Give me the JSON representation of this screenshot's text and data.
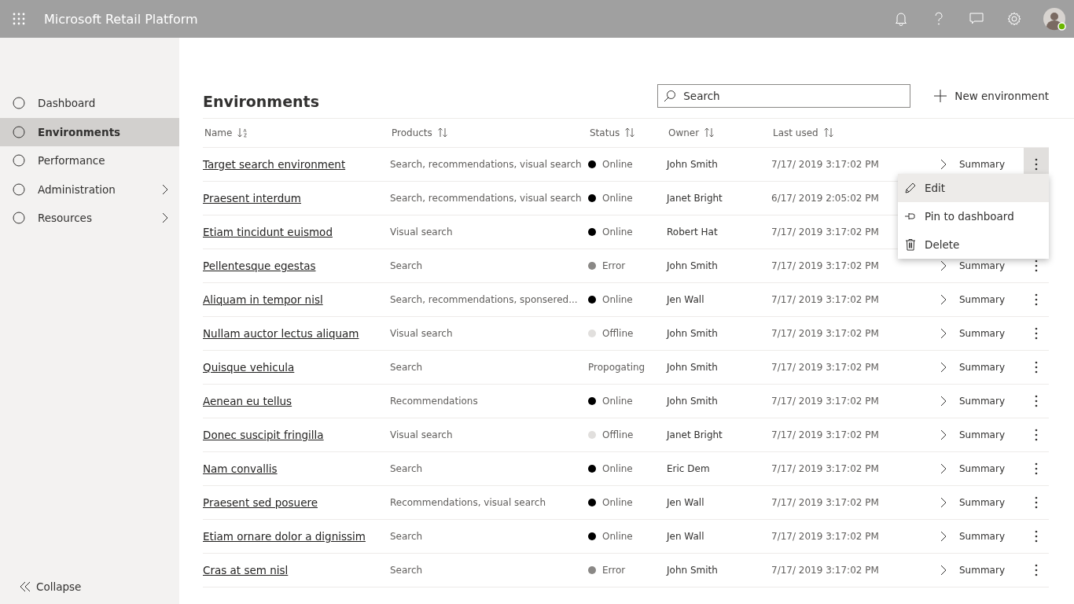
{
  "header": {
    "title": "Microsoft Retail Platform"
  },
  "sidebar": {
    "items": [
      {
        "label": "Dashboard",
        "selected": false,
        "expandable": false
      },
      {
        "label": "Environments",
        "selected": true,
        "expandable": false
      },
      {
        "label": "Performance",
        "selected": false,
        "expandable": false
      },
      {
        "label": "Administration",
        "selected": false,
        "expandable": true
      },
      {
        "label": "Resources",
        "selected": false,
        "expandable": true
      }
    ],
    "collapse": "Collapse"
  },
  "page": {
    "title": "Environments",
    "search": {
      "placeholder": "Search"
    },
    "new_button": "New environment"
  },
  "table": {
    "columns": [
      {
        "label": "Name",
        "kind": "az"
      },
      {
        "label": "Products",
        "kind": "both"
      },
      {
        "label": "Status",
        "kind": "both"
      },
      {
        "label": "Owner",
        "kind": "both"
      },
      {
        "label": "Last used",
        "kind": "both"
      }
    ],
    "rows": [
      {
        "name": "Target search environment",
        "products": "Search, recommendations, visual search",
        "status": "Online",
        "color": "#000000",
        "owner": "John Smith",
        "last_used": "7/17/ 2019 3:17:02 PM",
        "summary": "Summary",
        "more_selected": true
      },
      {
        "name": "Praesent interdum",
        "products": "Search, recommendations, visual search",
        "status": "Online",
        "color": "#000000",
        "owner": "Janet Bright",
        "last_used": "6/17/ 2019 2:05:02 PM"
      },
      {
        "name": "Etiam tincidunt euismod",
        "products": "Visual search",
        "status": "Online",
        "color": "#000000",
        "owner": "Robert Hat",
        "last_used": "7/17/ 2019 3:17:02 PM"
      },
      {
        "name": "Pellentesque egestas",
        "products": "Search",
        "status": "Error",
        "color": "#8a8886",
        "owner": "John Smith",
        "last_used": "7/17/ 2019 3:17:02 PM",
        "summary": "Summary",
        "more_selected": false
      },
      {
        "name": "Aliquam in tempor nisl",
        "products": "Search, recommendations, sponsered...",
        "status": "Online",
        "color": "#000000",
        "owner": "Jen Wall",
        "last_used": "7/17/ 2019 3:17:02 PM",
        "summary": "Summary",
        "more_selected": false
      },
      {
        "name": "Nullam auctor lectus aliquam",
        "products": "Visual search",
        "status": "Offline",
        "color": "#e1dfdd",
        "owner": "John Smith",
        "last_used": "7/17/ 2019 3:17:02 PM",
        "summary": "Summary",
        "more_selected": false
      },
      {
        "name": "Quisque vehicula",
        "products": "Search",
        "status": "Propogating",
        "owner": "John Smith",
        "last_used": "7/17/ 2019 3:17:02 PM",
        "summary": "Summary",
        "more_selected": false
      },
      {
        "name": "Aenean eu tellus",
        "products": "Recommendations",
        "status": "Online",
        "color": "#000000",
        "owner": "John Smith",
        "last_used": "7/17/ 2019 3:17:02 PM",
        "summary": "Summary",
        "more_selected": false
      },
      {
        "name": "Donec suscipit fringilla",
        "products": "Visual search",
        "status": "Offline",
        "color": "#e1dfdd",
        "owner": "Janet Bright",
        "last_used": "7/17/ 2019 3:17:02 PM",
        "summary": "Summary",
        "more_selected": false
      },
      {
        "name": "Nam convallis",
        "products": "Search",
        "status": "Online",
        "color": "#000000",
        "owner": "Eric Dem",
        "last_used": "7/17/ 2019 3:17:02 PM",
        "summary": "Summary",
        "more_selected": false
      },
      {
        "name": "Praesent sed posuere",
        "products": "Recommendations, visual search",
        "status": "Online",
        "color": "#000000",
        "owner": "Jen Wall",
        "last_used": "7/17/ 2019 3:17:02 PM",
        "summary": "Summary",
        "more_selected": false
      },
      {
        "name": "Etiam ornare dolor a dignissim",
        "products": "Search",
        "status": "Online",
        "color": "#000000",
        "owner": "Jen Wall",
        "last_used": "7/17/ 2019 3:17:02 PM",
        "summary": "Summary",
        "more_selected": false
      },
      {
        "name": "Cras at sem nisl",
        "products": "Search",
        "status": "Error",
        "color": "#8a8886",
        "owner": "John Smith",
        "last_used": "7/17/ 2019 3:17:02 PM",
        "summary": "Summary",
        "more_selected": false
      }
    ]
  },
  "context_menu": {
    "items": [
      {
        "kind": "edit",
        "label": "Edit",
        "selected": true
      },
      {
        "kind": "pin",
        "label": "Pin to dashboard",
        "selected": false
      },
      {
        "kind": "delete",
        "label": "Delete",
        "selected": false
      }
    ]
  }
}
